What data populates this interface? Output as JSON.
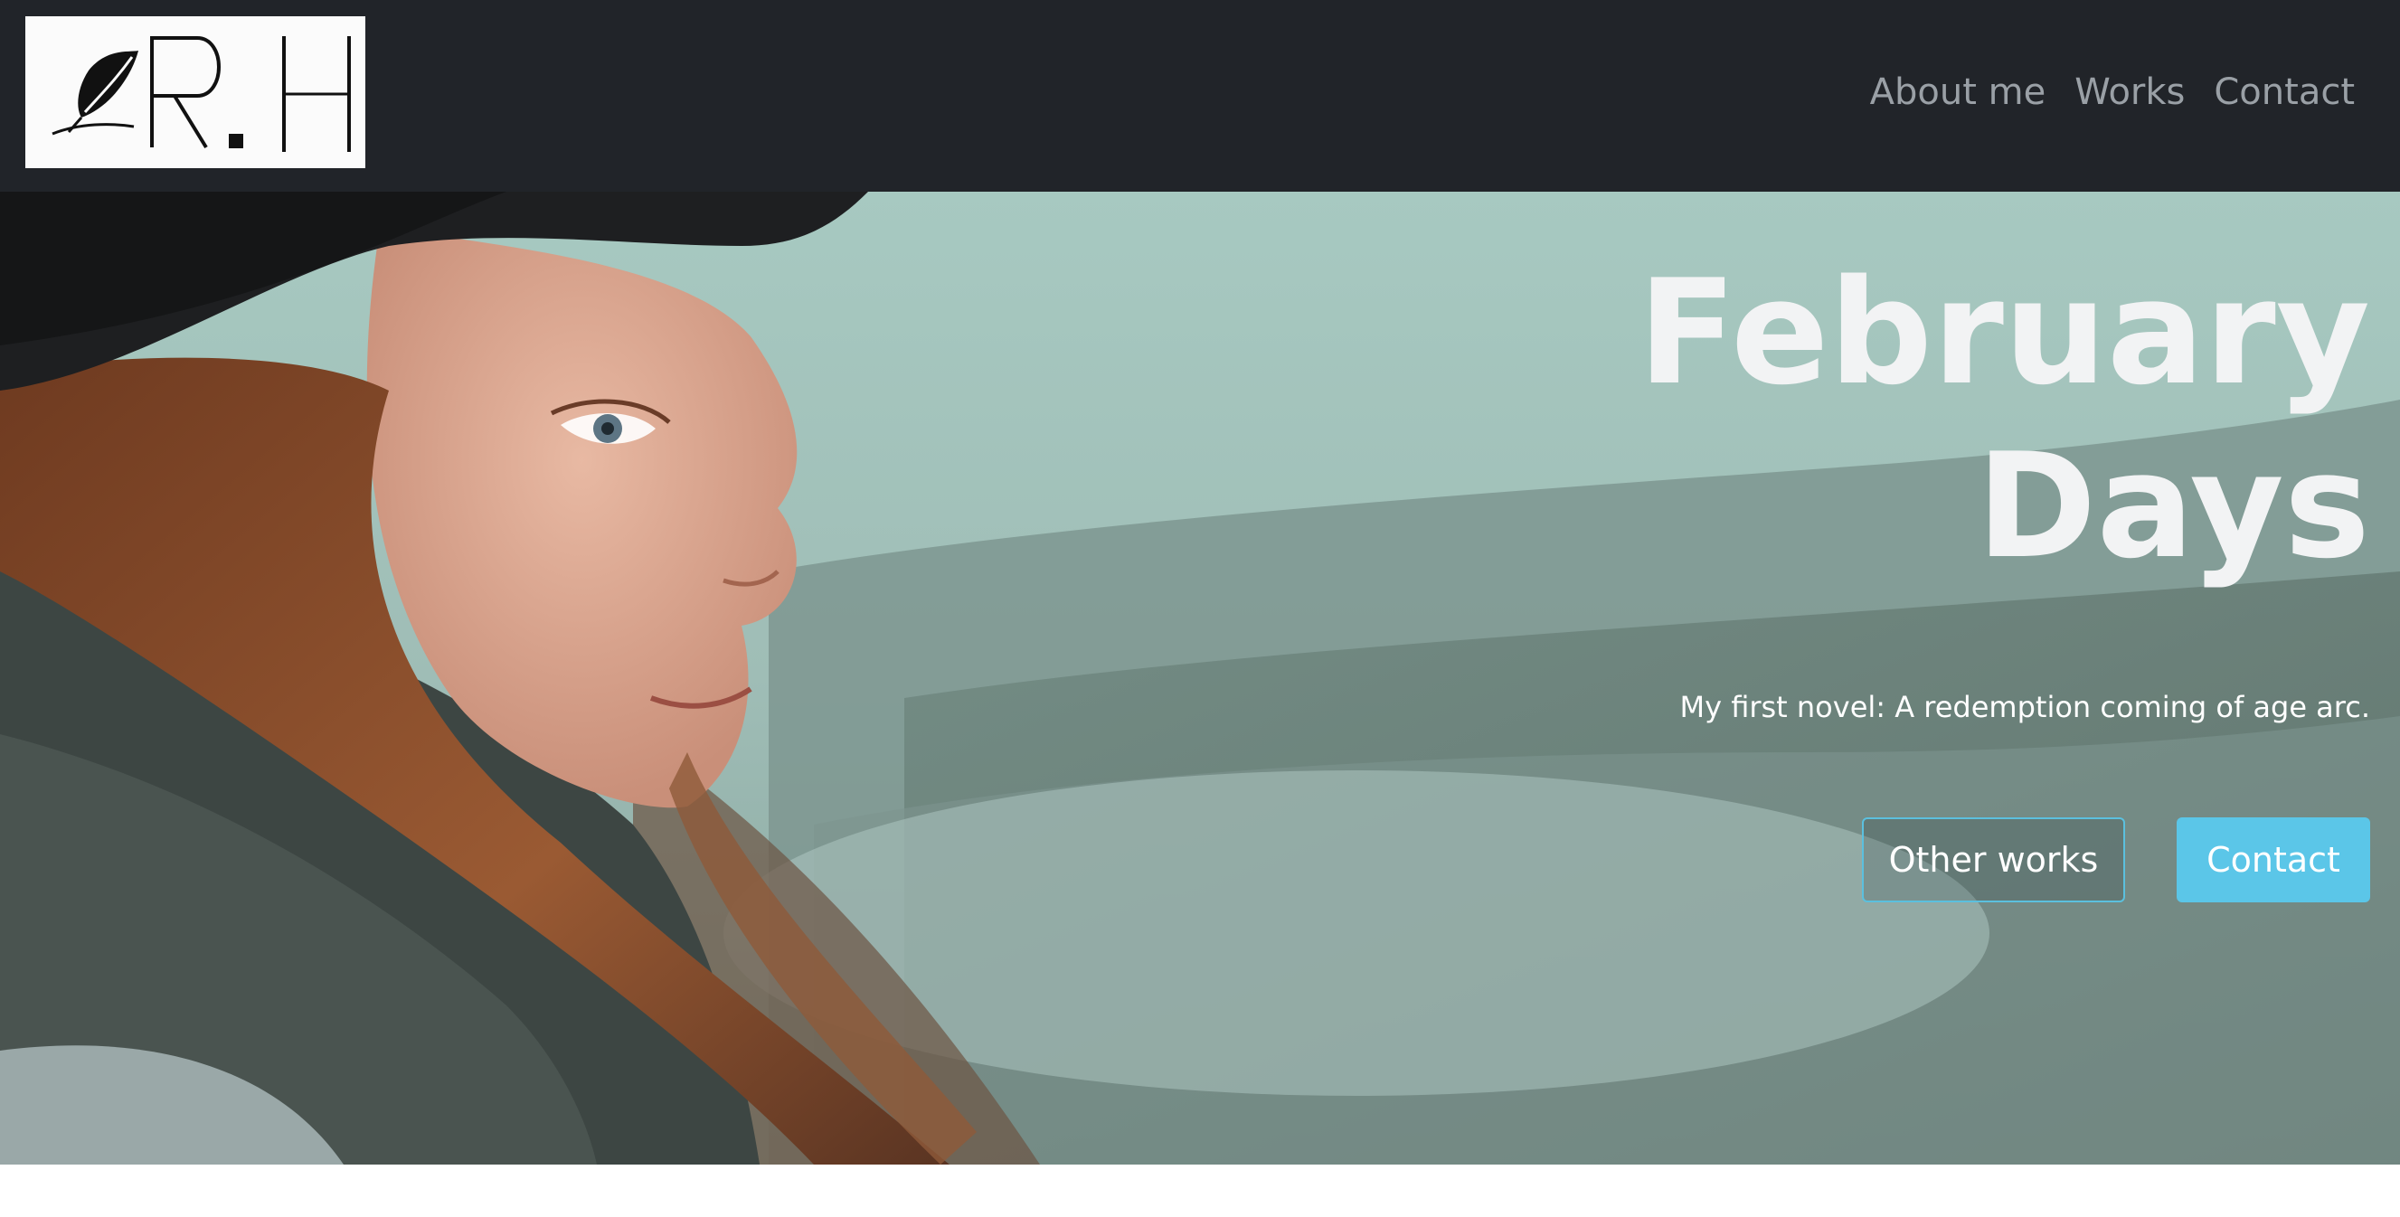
{
  "brand": {
    "logo_text": "R.H"
  },
  "nav": {
    "items": [
      {
        "label": "About me"
      },
      {
        "label": "Works"
      },
      {
        "label": "Contact"
      }
    ]
  },
  "hero": {
    "title_line1": "February",
    "title_line2": "Days",
    "subtitle": "My first novel: A redemption coming of age arc.",
    "buttons": {
      "other_works": "Other works",
      "contact": "Contact"
    }
  },
  "colors": {
    "navbar_bg": "#212429",
    "nav_link": "#9aa0a6",
    "accent": "#5bc6e8",
    "hero_text": "#f2f3f4"
  }
}
